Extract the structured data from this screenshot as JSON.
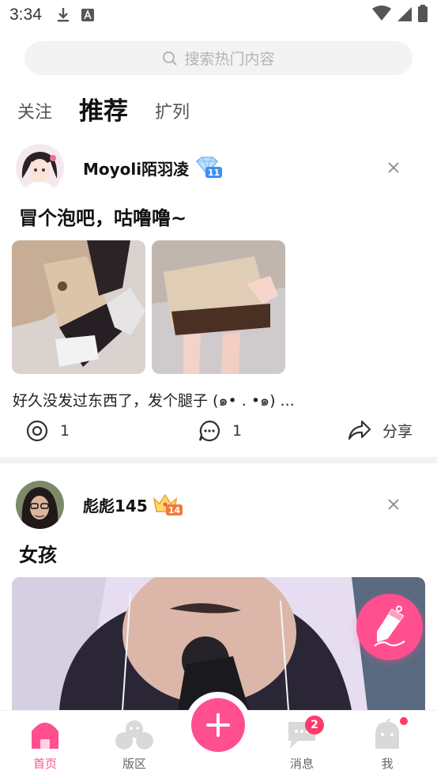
{
  "status_bar": {
    "time": "3:34"
  },
  "search": {
    "placeholder": "搜索热门内容"
  },
  "tabs": [
    {
      "label": "关注",
      "active": false
    },
    {
      "label": "推荐",
      "active": true
    },
    {
      "label": "扩列",
      "active": false
    }
  ],
  "posts": [
    {
      "user_name": "Moyoli陌羽凌",
      "level": "11",
      "title": "冒个泡吧，咕噜噜~",
      "text": "好久没发过东西了，发个腿子 (๑• . •๑) ...",
      "views": "1",
      "comments": "1",
      "share_label": "分享"
    },
    {
      "user_name": "彪彪145",
      "level": "14",
      "title": "女孩"
    }
  ],
  "bottom_nav": {
    "items": [
      {
        "label": "首页",
        "active": true
      },
      {
        "label": "版区",
        "active": false
      },
      {
        "label": "消息",
        "active": false,
        "badge": "2"
      },
      {
        "label": "我",
        "active": false
      }
    ]
  },
  "colors": {
    "accent": "#ff4f8f",
    "badge": "#ff3b6b",
    "tab_highlight": "#ffb9d6"
  }
}
